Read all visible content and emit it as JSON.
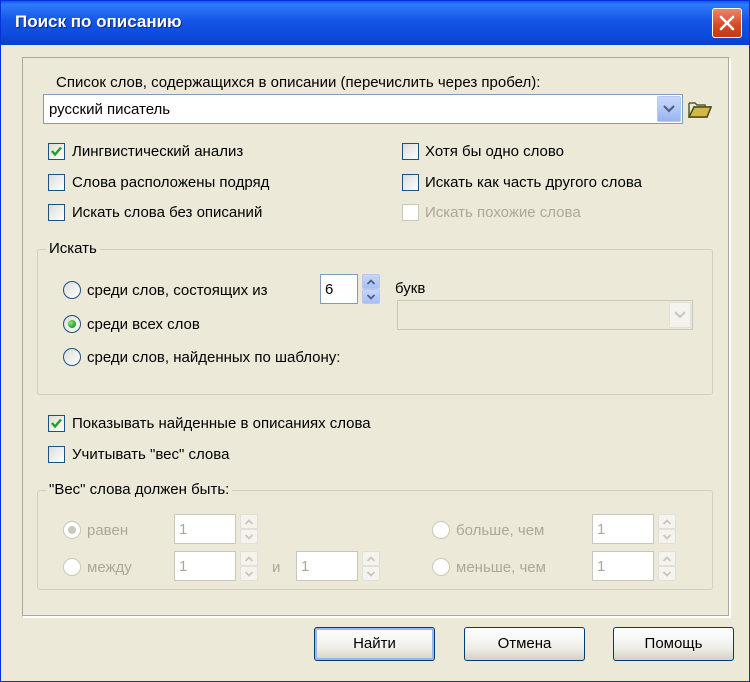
{
  "window": {
    "title": "Поиск по описанию"
  },
  "words": {
    "label": "Список слов, содержащихся в описании (перечислить через пробел):",
    "value": "русский писатель"
  },
  "options": {
    "linguistic": {
      "label": "Лингвистический анализ",
      "checked": true
    },
    "at_least_one": {
      "label": "Хотя бы одно слово",
      "checked": false
    },
    "consecutive": {
      "label": "Слова расположены подряд",
      "checked": false
    },
    "part_of_word": {
      "label": "Искать как часть другого слова",
      "checked": false
    },
    "without_desc": {
      "label": "Искать слова без описаний",
      "checked": false
    },
    "similar": {
      "label": "Искать похожие слова",
      "checked": false,
      "disabled": true
    }
  },
  "search_group": {
    "title": "Искать",
    "radio_length": {
      "label": "среди слов, состоящих из",
      "checked": false
    },
    "length_value": "6",
    "letters_label": "букв",
    "radio_all": {
      "label": "среди всех слов",
      "checked": true
    },
    "radio_template": {
      "label": "среди слов, найденных по шаблону:",
      "checked": false
    }
  },
  "show_found": {
    "label": "Показывать найденные в описаниях слова",
    "checked": true
  },
  "use_weight": {
    "label": "Учитывать \"вес\" слова",
    "checked": false
  },
  "weight_group": {
    "title": "\"Вес\" слова должен быть:",
    "equal": {
      "label": "равен",
      "value": "1",
      "checked": true
    },
    "between": {
      "label": "между",
      "value_from": "1",
      "and_label": "и",
      "value_to": "1",
      "checked": false
    },
    "greater": {
      "label": "больше, чем",
      "value": "1",
      "checked": false
    },
    "less": {
      "label": "меньше, чем",
      "value": "1",
      "checked": false
    }
  },
  "buttons": {
    "find": "Найти",
    "cancel": "Отмена",
    "help": "Помощь"
  },
  "colors": {
    "titlebar": "#0c4adb",
    "dialog_bg": "#ece9d8",
    "check_green": "#21a121",
    "disabled_text": "#aca899"
  },
  "icons": {
    "close": "close-icon",
    "dropdown": "chevron-down-icon",
    "folder": "folder-open-icon",
    "check": "check-icon"
  }
}
